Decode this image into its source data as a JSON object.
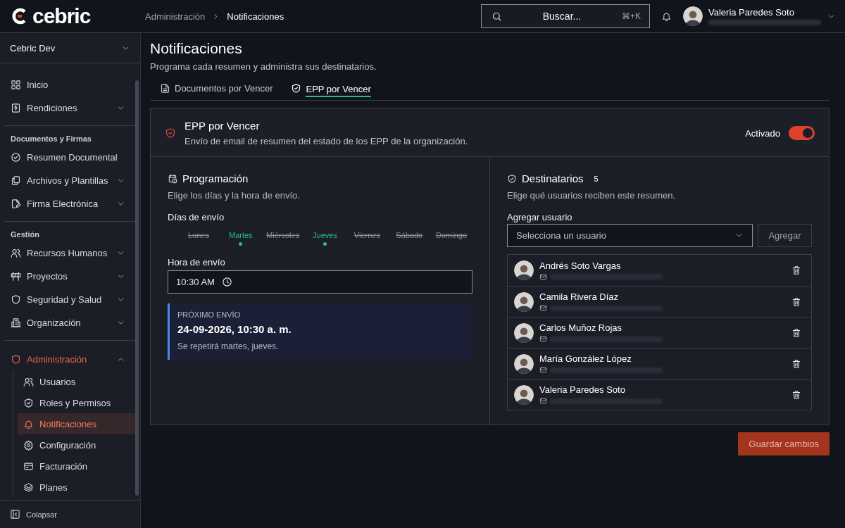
{
  "logo": {
    "text": "cebric"
  },
  "breadcrumb": [
    {
      "label": "Administración",
      "current": false
    },
    {
      "label": "Notificaciones",
      "current": true
    }
  ],
  "search": {
    "placeholder": "Buscar...",
    "shortcut": "⌘+K"
  },
  "user": {
    "name": "Valeria Paredes Soto"
  },
  "sidebar": {
    "workspace": "Cebric Dev",
    "sections": [
      {
        "items": [
          {
            "label": "Inicio",
            "selected": false
          },
          {
            "label": "Rendiciones",
            "expanded": false,
            "selected": false
          }
        ]
      },
      {
        "title": "Documentos y Firmas",
        "items": [
          {
            "label": "Resumen Documental",
            "selected": false
          },
          {
            "label": "Archivos y Plantillas",
            "expanded": false,
            "selected": false
          },
          {
            "label": "Firma Electrónica",
            "expanded": false,
            "selected": false
          }
        ]
      },
      {
        "title": "Gestión",
        "items": [
          {
            "label": "Recursos Humanos",
            "expanded": false,
            "selected": false
          },
          {
            "label": "Proyectos",
            "expanded": false,
            "selected": false
          },
          {
            "label": "Seguridad y Salud",
            "expanded": false,
            "selected": false
          },
          {
            "label": "Organización",
            "expanded": false,
            "selected": false
          }
        ]
      },
      {
        "items": [
          {
            "label": "Administración",
            "expanded": true,
            "selected": true,
            "children": [
              {
                "label": "Usuarios",
                "selected": false
              },
              {
                "label": "Roles y Permisos",
                "selected": false
              },
              {
                "label": "Notificaciones",
                "selected": true
              },
              {
                "label": "Configuración",
                "selected": false
              },
              {
                "label": "Facturación",
                "selected": false
              },
              {
                "label": "Planes",
                "selected": false
              }
            ]
          }
        ]
      }
    ],
    "collapse": "Colapsar"
  },
  "page": {
    "title": "Notificaciones",
    "subtitle": "Programa cada resumen y administra sus destinatarios."
  },
  "tabs": [
    {
      "label": "Documentos por Vencer",
      "selected": false
    },
    {
      "label": "EPP por Vencer",
      "selected": true
    }
  ],
  "card": {
    "title": "EPP por Vencer",
    "description": "Envío de email de resumen del estado de los EPP de la organización.",
    "toggle": {
      "label": "Activado",
      "on": true
    }
  },
  "schedule": {
    "title": "Programación",
    "subtitle": "Elige los días y la hora de envío.",
    "days_label": "Días de envío",
    "days": [
      {
        "label": "Lunes",
        "selected": false
      },
      {
        "label": "Martes",
        "selected": true
      },
      {
        "label": "Miércoles",
        "selected": false
      },
      {
        "label": "Jueves",
        "selected": true
      },
      {
        "label": "Viernes",
        "selected": false
      },
      {
        "label": "Sábado",
        "selected": false
      },
      {
        "label": "Domingo",
        "selected": false
      }
    ],
    "time_label": "Hora de envío",
    "time_value": "10:30 AM",
    "next": {
      "label": "PRÓXIMO ENVÍO",
      "date": "24-09-2026, 10:30 a. m.",
      "repeat": "Se repetirá martes, jueves."
    }
  },
  "recipients": {
    "title": "Destinatarios",
    "count": "5",
    "subtitle": "Elige qué usuarios reciben este resumen.",
    "add_label": "Agregar usuario",
    "select_placeholder": "Selecciona un usuario",
    "add_button": "Agregar",
    "list": [
      {
        "name": "Andrés Soto Vargas"
      },
      {
        "name": "Camila Rivera Díaz"
      },
      {
        "name": "Carlos Muñoz Rojas"
      },
      {
        "name": "María González López"
      },
      {
        "name": "Valeria Paredes Soto"
      }
    ]
  },
  "save_button": "Guardar cambios"
}
